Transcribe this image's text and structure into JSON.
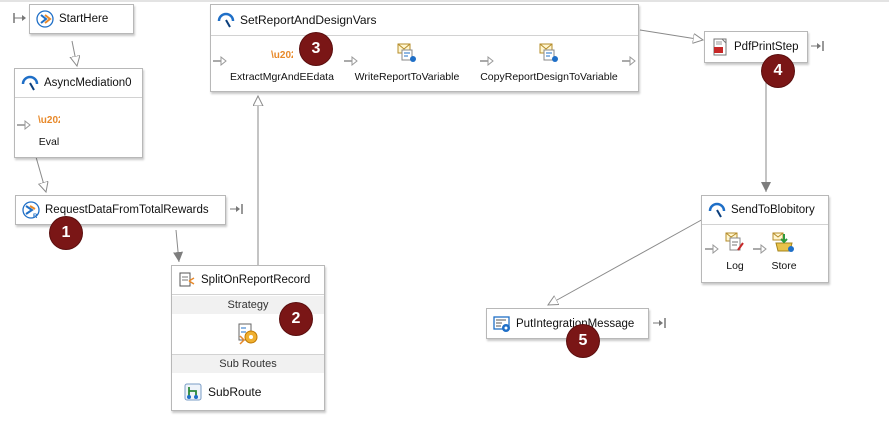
{
  "nodes": {
    "start_here": {
      "title": "StartHere"
    },
    "async_mediation": {
      "title": "AsyncMediation0",
      "steps": [
        {
          "label": "Eval"
        }
      ]
    },
    "request_data": {
      "title": "RequestDataFromTotalRewards"
    },
    "split_on_report": {
      "title": "SplitOnReportRecord",
      "strategy_label": "Strategy",
      "subroutes_label": "Sub Routes",
      "subroute": "SubRoute"
    },
    "set_report_vars": {
      "title": "SetReportAndDesignVars",
      "steps": [
        {
          "label": "ExtractMgrAndEEdata"
        },
        {
          "label": "WriteReportToVariable"
        },
        {
          "label": "CopyReportDesignToVariable"
        }
      ]
    },
    "pdf_print": {
      "title": "PdfPrintStep"
    },
    "send_to_blobitory": {
      "title": "SendToBlobitory",
      "steps": [
        {
          "label": "Log"
        },
        {
          "label": "Store"
        }
      ]
    },
    "put_integration": {
      "title": "PutIntegrationMessage"
    }
  },
  "badges": [
    "1",
    "2",
    "3",
    "4",
    "5"
  ],
  "colors": {
    "badge": "#7a1616",
    "connector": "#8a8a8a",
    "accent_blue": "#1f6fc7",
    "accent_orange": "#e8892a"
  },
  "icons": [
    "route-icon",
    "mediation-icon",
    "connector-icon",
    "split-icon",
    "eval-icon",
    "write-variable-icon",
    "pdf-icon",
    "log-icon",
    "store-icon",
    "integration-message-icon",
    "subroute-icon",
    "strategy-icon"
  ]
}
